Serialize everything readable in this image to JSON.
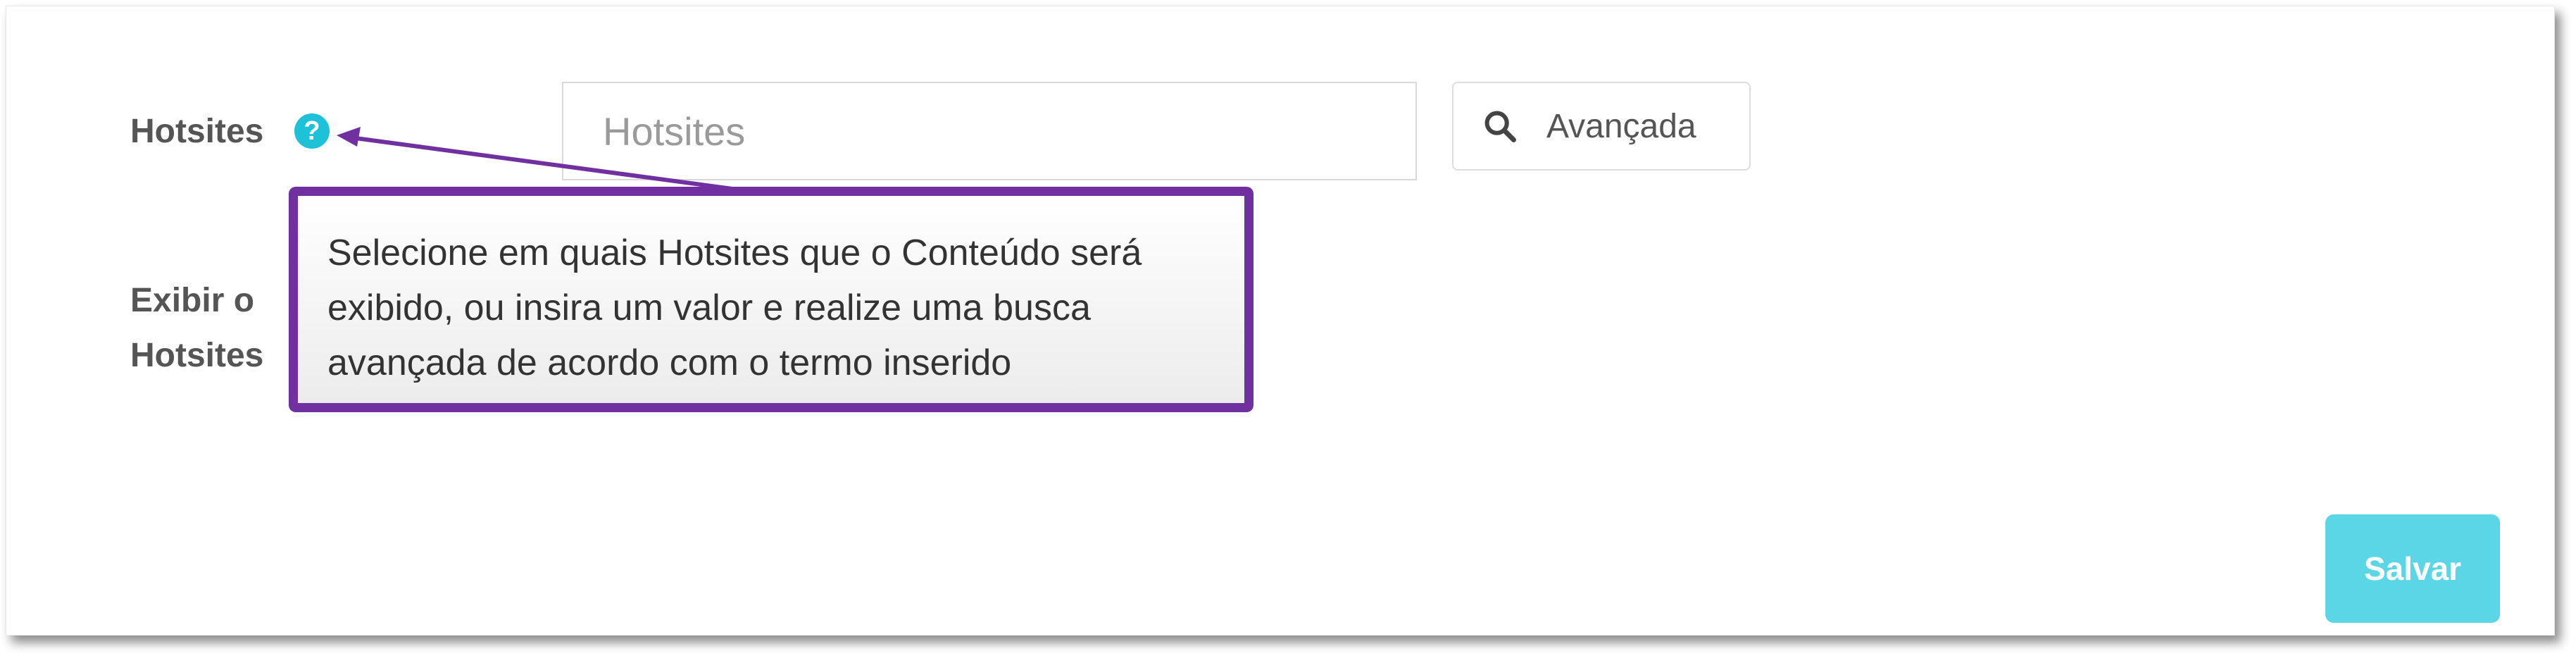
{
  "form": {
    "hotsites_label": "Hotsites",
    "help_icon_glyph": "?",
    "search_placeholder": "Hotsites",
    "search_value": "",
    "advanced_button_label": "Avançada",
    "exibir_label_line1": "Exibir o",
    "exibir_label_line2": "Hotsites"
  },
  "tooltip": {
    "text": "Selecione em quais Hotsites que o Conteúdo será exibido, ou insira um valor e realize uma busca avançada de acordo com o termo inserido"
  },
  "actions": {
    "save_label": "Salvar"
  },
  "colors": {
    "accent_cyan": "#1ec2d8",
    "save_button": "#5bd6e6",
    "annotation_purple": "#7030a0"
  },
  "icons": {
    "help": "question-circle-icon",
    "search": "magnifier-icon"
  }
}
